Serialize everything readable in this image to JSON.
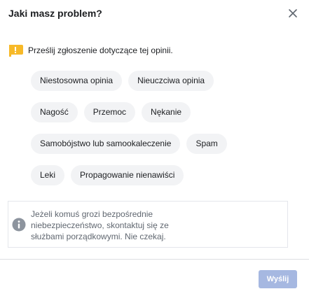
{
  "dialog": {
    "title": "Jaki masz problem?",
    "close_icon": "close-icon",
    "subtitle_icon": "flag-icon",
    "subtitle": "Prześlij zgłoszenie dotyczące tej opinii.",
    "chip_rows": [
      [
        "Niestosowna opinia",
        "Nieuczciwa opinia"
      ],
      [
        "Nagość",
        "Przemoc",
        "Nękanie"
      ],
      [
        "Samobójstwo lub samookaleczenie",
        "Spam"
      ],
      [
        "Leki",
        "Propagowanie nienawiści"
      ]
    ],
    "info": {
      "icon": "info-icon",
      "lines": [
        "Jeżeli komuś grozi bezpośrednie",
        "niebezpieczeństwo, skontaktuj się ze",
        "służbami porządkowymi. Nie czekaj."
      ]
    },
    "send_label": "Wyślij"
  },
  "colors": {
    "accent_flag": "#f7b928",
    "chip_bg": "#f2f3f5",
    "send_disabled_bg": "#a6b8e1",
    "info_icon": "#8d949e"
  }
}
